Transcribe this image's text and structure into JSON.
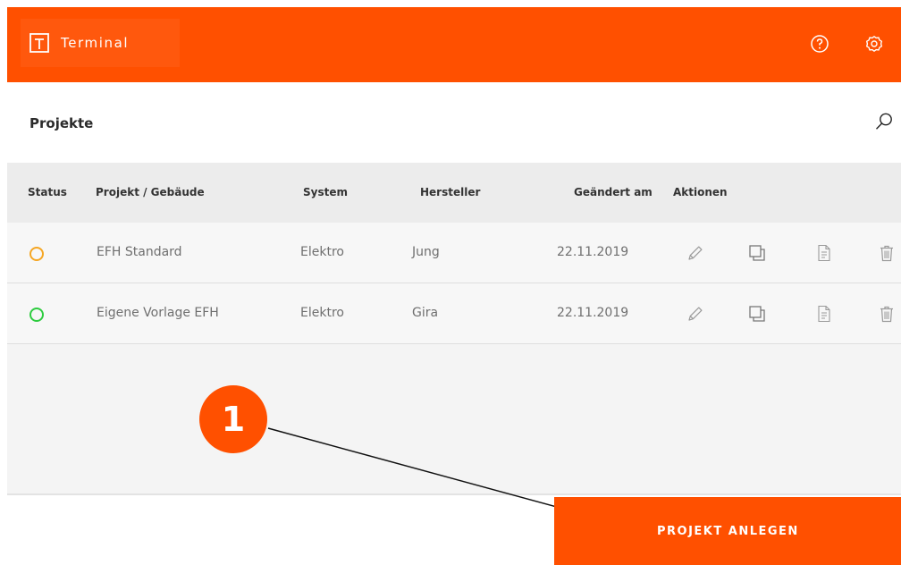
{
  "app": {
    "name": "Terminal",
    "accent_color": "#ff5000",
    "icons": [
      "terminal-logo-icon",
      "help-icon",
      "gear-icon",
      "search-icon",
      "edit-icon",
      "duplicate-icon",
      "document-icon",
      "trash-icon"
    ]
  },
  "page": {
    "title": "Projekte"
  },
  "table": {
    "columns": [
      "Status",
      "Projekt / Gebäude",
      "System",
      "Hersteller",
      "Geändert am",
      "Aktionen"
    ],
    "rows": [
      {
        "status_color": "#f5a623",
        "project": "EFH Standard",
        "system": "Elektro",
        "manufacturer": "Jung",
        "changed": "22.11.2019"
      },
      {
        "status_color": "#2ecc40",
        "project": "Eigene Vorlage EFH",
        "system": "Elektro",
        "manufacturer": "Gira",
        "changed": "22.11.2019"
      }
    ]
  },
  "annotation": {
    "number": "1"
  },
  "actions": {
    "create_project": "PROJEKT ANLEGEN"
  }
}
